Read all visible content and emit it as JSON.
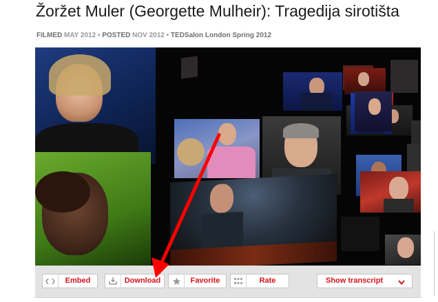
{
  "page": {
    "title": "Žoržet Muler (Georgette Mulheir): Tragedija sirotišta"
  },
  "meta": {
    "filmed_label": "FILMED",
    "filmed_date": "MAY 2012",
    "sep1": "•",
    "posted_label": "POSTED",
    "posted_date": "NOV 2012",
    "sep2": "•",
    "event": "TEDSalon London Spring 2012"
  },
  "toolbar": {
    "embed_label": "Embed",
    "download_label": "Download",
    "favorite_label": "Favorite",
    "rate_label": "Rate",
    "transcript_label": "Show transcript"
  },
  "icons": {
    "embed": "code-brackets-icon",
    "download": "download-tray-icon",
    "favorite": "star-icon",
    "rate": "rating-grid-icon",
    "transcript": "chevron-down-icon",
    "annotation": "red-arrow"
  },
  "colors": {
    "accent": "#d3141e",
    "annotation_arrow": "#ff0000",
    "toolbar_bg": "#e3e3e3",
    "video_bg": "#050505"
  }
}
